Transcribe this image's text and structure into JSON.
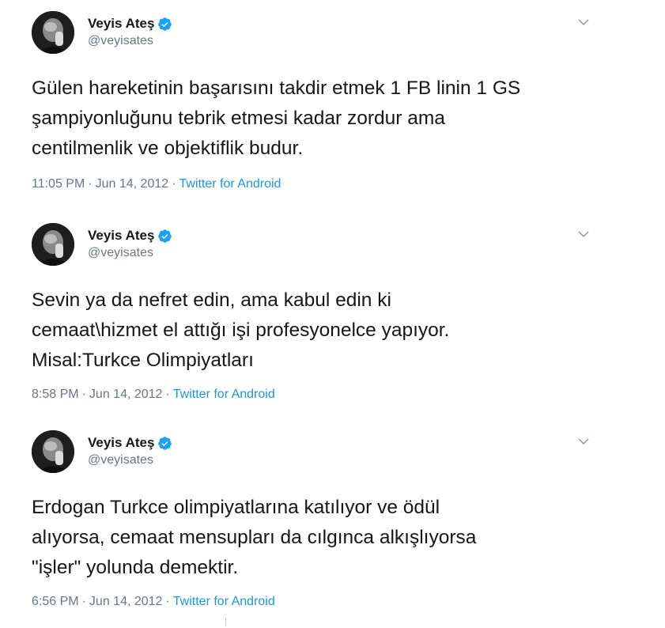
{
  "tweets": [
    {
      "name": "Veyis Ateş",
      "handle": "@veyisates",
      "lines": [
        "Gülen hareketinin başarısını takdir etmek 1 FB linin 1 GS",
        "şampiyonluğunu tebrik etmesi kadar zordur ama",
        "centilmenlik ve objektiflik budur."
      ],
      "time": "11:05 PM",
      "date": "Jun 14, 2012",
      "source": "Twitter for Android"
    },
    {
      "name": "Veyis Ateş",
      "handle": "@veyisates",
      "lines": [
        "Sevin ya da nefret edin, ama kabul edin ki",
        "cemaat\\hizmet el attığı işi profesyonelce yapıyor.",
        "Misal:Turkce Olimpiyatları"
      ],
      "time": "8:58 PM",
      "date": "Jun 14, 2012",
      "source": "Twitter for Android"
    },
    {
      "name": "Veyis Ateş",
      "handle": "@veyisates",
      "lines": [
        "Erdogan Turkce olimpiyatlarına katılıyor ve ödül",
        "alıyorsa, cemaat mensupları da cılgınca alkışlıyorsa",
        "\"işler\" yolunda demektir."
      ],
      "time": "6:56 PM",
      "date": "Jun 14, 2012",
      "source": "Twitter for Android"
    }
  ],
  "meta_separator": "·",
  "icons": {
    "verified": "verified-badge-icon",
    "caret": "chevron-down-icon"
  },
  "colors": {
    "text": "#14171a",
    "secondary": "#657786",
    "link": "#1b95e0",
    "verified": "#1da1f2"
  }
}
